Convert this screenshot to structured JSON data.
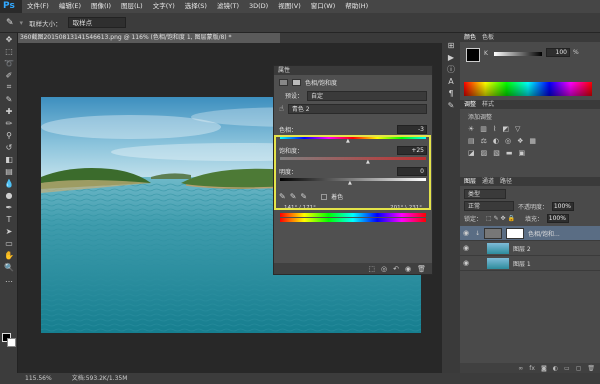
{
  "app": {
    "logo": "Ps"
  },
  "menu": [
    "文件(F)",
    "编辑(E)",
    "图像(I)",
    "图层(L)",
    "文字(Y)",
    "选择(S)",
    "滤镜(T)",
    "3D(D)",
    "视图(V)",
    "窗口(W)",
    "帮助(H)"
  ],
  "options": {
    "sample_size_label": "取样大小：",
    "sample_size_value": "取样点"
  },
  "document": {
    "tab_title": "360截图20150813141546613.png @ 116% (色相/饱和度 1, 图层蒙版/8) *"
  },
  "status": {
    "zoom": "115.56%",
    "doc": "文档:593.2K/1.35M"
  },
  "properties": {
    "title": "属性",
    "header": "色相/饱和度",
    "preset_label": "预设：",
    "preset_value": "自定",
    "channel_value": "青色 2",
    "hue_label": "色相：",
    "hue_value": "-3",
    "sat_label": "饱和度：",
    "sat_value": "+25",
    "light_label": "明度：",
    "light_value": "0",
    "colorize_label": "着色",
    "range_left": "141° / 171°",
    "range_right": "201° \\ 231°"
  },
  "color_panel": {
    "tabs": [
      "颜色",
      "色板"
    ],
    "k_label": "K",
    "k_value": "100",
    "k_unit": "%"
  },
  "adjust_panel": {
    "tabs": [
      "调整",
      "样式"
    ],
    "title": "添加调整"
  },
  "layers_panel": {
    "tabs": [
      "图层",
      "通道",
      "路径"
    ],
    "filter_value": "类型",
    "blend_mode": "正常",
    "opacity_label": "不透明度：",
    "opacity_value": "100%",
    "lock_label": "锁定：",
    "fill_label": "填充：",
    "fill_value": "100%",
    "layers": [
      {
        "name": "色相/饱和...",
        "type": "adjustment"
      },
      {
        "name": "图层 2",
        "type": "image"
      },
      {
        "name": "图层 1",
        "type": "image"
      }
    ]
  }
}
